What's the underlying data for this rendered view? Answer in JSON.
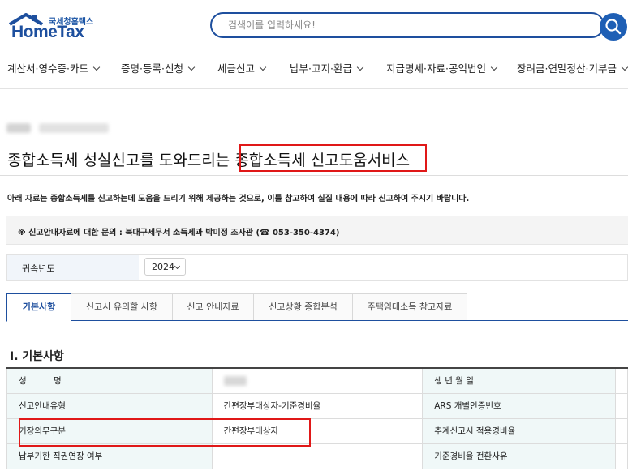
{
  "header": {
    "logo_kr": "국세청홈택스",
    "logo_en": "HomeTax",
    "search_placeholder": "검색어를 입력하세요!",
    "search_icon": "search-icon"
  },
  "nav": [
    {
      "label": "계산서·영수증·카드"
    },
    {
      "label": "증명·등록·신청"
    },
    {
      "label": "세금신고"
    },
    {
      "label": "납부·고지·환급"
    },
    {
      "label": "지급명세·자료·공익법인"
    },
    {
      "label": "장려금·연말정산·기부금"
    }
  ],
  "page": {
    "title_prefix": "종합소득세 성실신고를 도와드리는 ",
    "title_highlight": "종합소득세 신고도움서비스",
    "description": "아래 자료는 종합소득세를 신고하는데 도움을 드리기 위해 제공하는 것으로, 이를 참고하여 실질 내용에 따라 신고하여 주시기 바랍니다.",
    "notice": "※ 신고안내자료에 대한 문의 : 북대구세무서 소득세과 박미정 조사관 (☎ 053-350-4374)",
    "year_label": "귀속년도",
    "year_value": "2024",
    "highlight_color": "#e01818",
    "accent_color": "#1e4f9e"
  },
  "tabs": [
    {
      "label": "기본사항",
      "active": true
    },
    {
      "label": "신고시 유의할 사항",
      "active": false
    },
    {
      "label": "신고 안내자료",
      "active": false
    },
    {
      "label": "신고상황 종합분석",
      "active": false
    },
    {
      "label": "주택임대소득 참고자료",
      "active": false
    }
  ],
  "section": {
    "title": "Ⅰ. 기본사항",
    "rows": [
      {
        "h1": "성          명",
        "v1": "",
        "h2": "생 년 월 일",
        "v2": ""
      },
      {
        "h1": "신고안내유형",
        "v1": "간편장부대상자-기준경비율",
        "h2": "ARS 개별인증번호",
        "v2": ""
      },
      {
        "h1": "기장의무구분",
        "v1": "간편장부대상자",
        "h2": "추계신고시 적용경비율",
        "v2": ""
      },
      {
        "h1": "납부기한 직권연장 여부",
        "v1": "",
        "h2": "기준경비율 전환사유",
        "v2": ""
      }
    ]
  }
}
